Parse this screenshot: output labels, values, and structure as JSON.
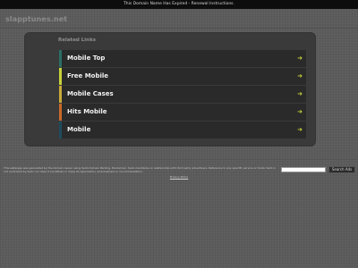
{
  "notice": {
    "text": "This Domain Name Has Expired - Renewal Instructions."
  },
  "site": {
    "name": "slapptunes.net"
  },
  "related": {
    "title": "Related Links",
    "links": [
      {
        "label": "Mobile Top",
        "accent": "#2b6e66"
      },
      {
        "label": "Free Mobile",
        "accent": "#c7d13b"
      },
      {
        "label": "Mobile Cases",
        "accent": "#c9a93a"
      },
      {
        "label": "Hits Mobile",
        "accent": "#c9692a"
      },
      {
        "label": "Mobile",
        "accent": "#1f4c5e"
      }
    ],
    "arrow_color": "#c6d23b"
  },
  "footer": {
    "disclaimer": "This webpage was generated by the domain owner using Sedo Domain Parking. Disclaimer: Sedo maintains no relationship with third party advertisers. Reference to any specific service or trade mark is not controlled by Sedo nor does it constitute or imply its association, endorsement or recommendation.",
    "search_placeholder": "",
    "search_button": "Search Ads",
    "privacy": "Privacy Policy"
  }
}
